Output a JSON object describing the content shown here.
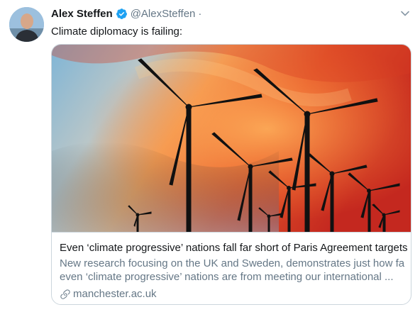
{
  "author": {
    "name": "Alex Steffen",
    "handle": "@AlexSteffen",
    "separator": "·",
    "timestamp": "",
    "verified": true
  },
  "icons": {
    "verified": "verified-badge-icon",
    "caret": "chevron-down-icon",
    "link": "link-icon"
  },
  "tweet": {
    "text": "Climate diplomacy is failing:"
  },
  "card": {
    "title": "Even ‘climate progressive’ nations fall far short of Paris Agreement targets",
    "description_line1": "New research focusing on the UK and Sweden, demonstrates just how far",
    "description_line2": "even ‘climate progressive’ nations are from meeting our international ...",
    "domain": "manchester.ac.uk"
  },
  "colors": {
    "accent": "#1da1f2",
    "text_primary": "#14171a",
    "text_secondary": "#657786",
    "border": "#ccd6dd"
  }
}
